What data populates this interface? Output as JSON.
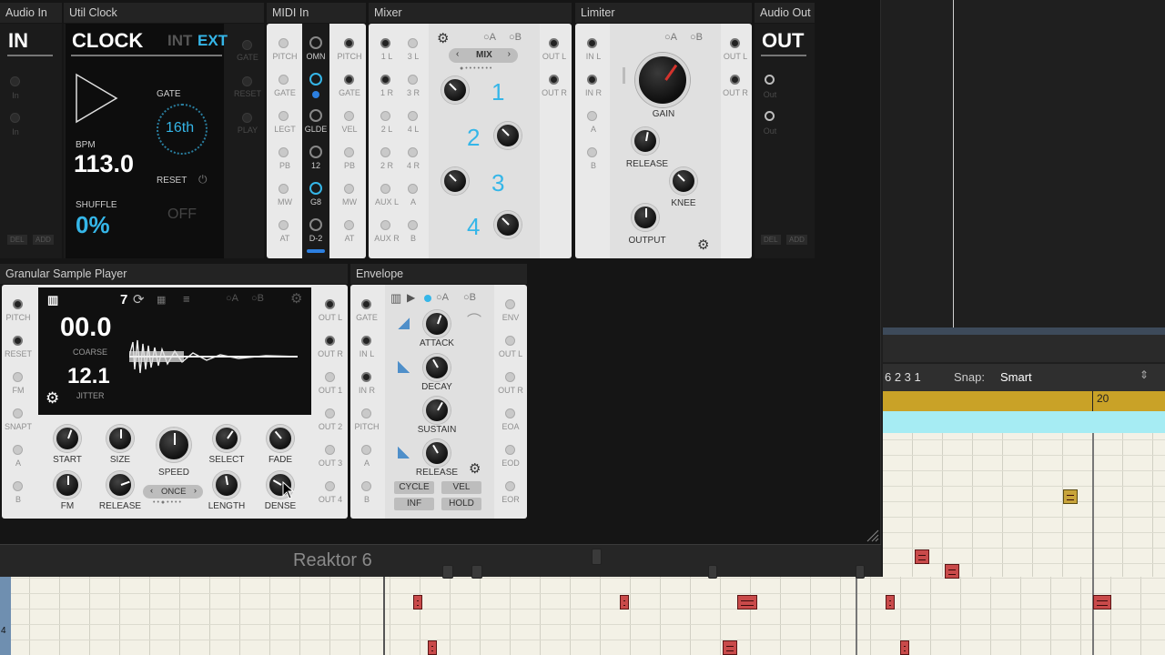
{
  "modules": {
    "audio_in": {
      "title": "Audio In",
      "big": "IN",
      "jacks": [
        "In",
        "In"
      ],
      "footer": [
        "DEL",
        "ADD"
      ]
    },
    "util_clock": {
      "title": "Util Clock",
      "name": "CLOCK",
      "int": "INT",
      "ext": "EXT",
      "gate_label": "GATE",
      "gate_value": "16th",
      "bpm_label": "BPM",
      "bpm": "113.0",
      "reset_label": "RESET",
      "shuffle_label": "SHUFFLE",
      "shuffle": "0%",
      "off": "OFF",
      "side_labels": [
        "GATE",
        "RESET",
        "PLAY"
      ]
    },
    "midi_in": {
      "title": "MIDI In",
      "left": [
        "PITCH",
        "GATE",
        "LEGT",
        "PB",
        "MW",
        "AT"
      ],
      "center": [
        "OMN",
        "GLDE",
        "12",
        "G8",
        "D-2"
      ],
      "right": [
        "PITCH",
        "GATE",
        "VEL",
        "PB",
        "MW",
        "AT"
      ]
    },
    "mixer": {
      "title": "Mixer",
      "ab": [
        "A",
        "B"
      ],
      "mode": "MIX",
      "inputs_left": [
        "1 L",
        "1 R",
        "2 L",
        "2 R",
        "AUX L",
        "AUX R"
      ],
      "inputs_right": [
        "3 L",
        "3 R",
        "4 L",
        "4 R",
        "A",
        "B"
      ],
      "channels": [
        "1",
        "2",
        "3",
        "4"
      ],
      "outputs": [
        "OUT L",
        "OUT R"
      ]
    },
    "limiter": {
      "title": "Limiter",
      "ab": [
        "A",
        "B"
      ],
      "inputs": [
        "IN L",
        "IN R",
        "A",
        "B"
      ],
      "knobs": [
        "GAIN",
        "RELEASE",
        "KNEE",
        "OUTPUT"
      ],
      "outputs": [
        "OUT L",
        "OUT R"
      ]
    },
    "audio_out": {
      "title": "Audio Out",
      "big": "OUT",
      "jacks": [
        "Out",
        "Out"
      ],
      "footer": [
        "DEL",
        "ADD"
      ]
    },
    "granular": {
      "title": "Granular Sample Player",
      "preset_num": "7",
      "ab": [
        "A",
        "B"
      ],
      "coarse": "00.0",
      "coarse_label": "COARSE",
      "jitter": "12.1",
      "jitter_label": "JITTER",
      "inputs": [
        "PITCH",
        "RESET",
        "FM",
        "SNAPT",
        "A",
        "B"
      ],
      "knobs_row1": [
        "START",
        "SIZE",
        "SPEED",
        "SELECT",
        "FADE"
      ],
      "knobs_row2": [
        "FM",
        "RELEASE",
        "LENGTH",
        "DENSE"
      ],
      "mode": "ONCE",
      "outputs": [
        "OUT L",
        "OUT R",
        "OUT 1",
        "OUT 2",
        "OUT 3",
        "OUT 4"
      ]
    },
    "envelope": {
      "title": "Envelope",
      "ab": [
        "A",
        "B"
      ],
      "inputs": [
        "GATE",
        "IN L",
        "IN R",
        "PITCH",
        "A",
        "B"
      ],
      "knobs": [
        "ATTACK",
        "DECAY",
        "SUSTAIN",
        "RELEASE"
      ],
      "buttons": [
        "CYCLE",
        "VEL",
        "INF",
        "HOLD"
      ],
      "outputs": [
        "ENV",
        "OUT L",
        "OUT R",
        "EOA",
        "EOD",
        "EOR"
      ]
    }
  },
  "window_title": "Reaktor 6",
  "piano_roll": {
    "position": "6 2 3 1",
    "snap_label": "Snap:",
    "snap_value": "Smart",
    "bar_marker": "20",
    "row_label": "4"
  },
  "colors": {
    "accent_blue": "#35b6e8",
    "note_red": "#c94a4a",
    "ruler_gold": "#c9a227",
    "ruler_cyan": "#a6ecf3",
    "gain_red": "#d4332d"
  }
}
